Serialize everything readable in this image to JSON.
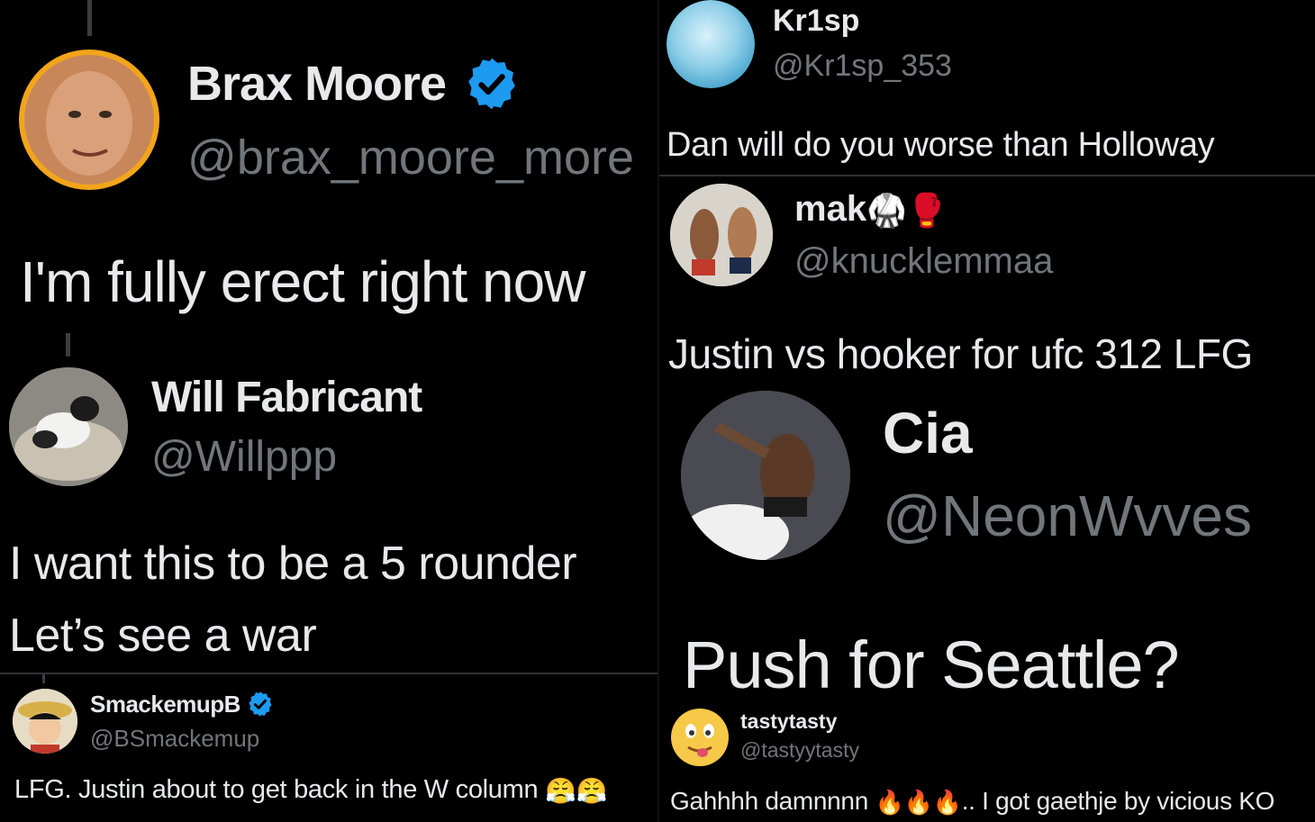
{
  "accent_color": "#1d9bf0",
  "posts": {
    "brax": {
      "name": "Brax Moore",
      "handle": "@brax_moore_more",
      "verified": true,
      "text": "I'm fully erect right now",
      "avatar_icon": "profile-photo-icon"
    },
    "will": {
      "name": "Will Fabricant",
      "handle": "@Willppp",
      "text_line1": "I want this to be a 5 rounder",
      "text_line2": "Let’s see a war",
      "avatar_icon": "dog-photo-icon"
    },
    "smack": {
      "name": "SmackemupB",
      "handle": "@BSmackemup",
      "verified": true,
      "text": "LFG. Justin about to get back in the W column",
      "emojis": "😤😤",
      "avatar_icon": "anime-avatar-icon"
    },
    "krisp": {
      "name": "Kr1sp",
      "handle": "@Kr1sp_353",
      "text": "Dan will do you worse than Holloway",
      "avatar_icon": "blue-avatar-icon"
    },
    "mak": {
      "name": "mak",
      "name_emojis": "🥋🥊",
      "handle": "@knucklemmaa",
      "text": "Justin vs hooker for ufc 312 LFG",
      "avatar_icon": "fighters-photo-icon"
    },
    "cia": {
      "name": "Cia",
      "handle": "@NeonWvves",
      "text": "Push for Seattle?",
      "avatar_icon": "fighter-photo-icon"
    },
    "tasty": {
      "name": "tastytasty",
      "handle": "@tastyytasty",
      "text_before": "Gahhhh damnnnn ",
      "fire_emojis": "🔥🔥🔥",
      "text_after": ".. I got gaethje by vicious KO",
      "avatar_icon": "yum-emoji-icon"
    }
  }
}
